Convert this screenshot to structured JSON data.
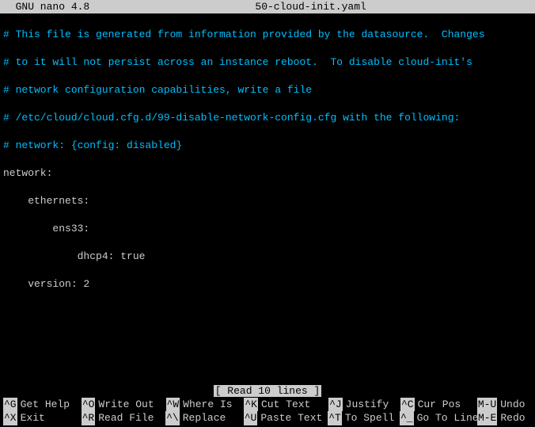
{
  "title": {
    "app": "  GNU nano 4.8",
    "filename": "50-cloud-init.yaml"
  },
  "content": {
    "comments": [
      "# This file is generated from information provided by the datasource.  Changes",
      "# to it will not persist across an instance reboot.  To disable cloud-init's",
      "# network configuration capabilities, write a file",
      "# /etc/cloud/cloud.cfg.d/99-disable-network-config.cfg with the following:",
      "# network: {config: disabled}"
    ],
    "yaml": [
      "network:",
      "    ethernets:",
      "        ens33:",
      "            dhcp4: true",
      "    version: 2"
    ]
  },
  "status": "[ Read 10 lines ]",
  "shortcuts": {
    "row1": [
      {
        "key": "^G",
        "label": "Get Help"
      },
      {
        "key": "^O",
        "label": "Write Out"
      },
      {
        "key": "^W",
        "label": "Where Is"
      },
      {
        "key": "^K",
        "label": "Cut Text"
      },
      {
        "key": "^J",
        "label": "Justify"
      },
      {
        "key": "^C",
        "label": "Cur Pos"
      },
      {
        "key": "M-U",
        "label": "Undo"
      }
    ],
    "row2": [
      {
        "key": "^X",
        "label": "Exit"
      },
      {
        "key": "^R",
        "label": "Read File"
      },
      {
        "key": "^\\",
        "label": "Replace"
      },
      {
        "key": "^U",
        "label": "Paste Text"
      },
      {
        "key": "^T",
        "label": "To Spell"
      },
      {
        "key": "^_",
        "label": "Go To Line"
      },
      {
        "key": "M-E",
        "label": "Redo"
      }
    ]
  }
}
